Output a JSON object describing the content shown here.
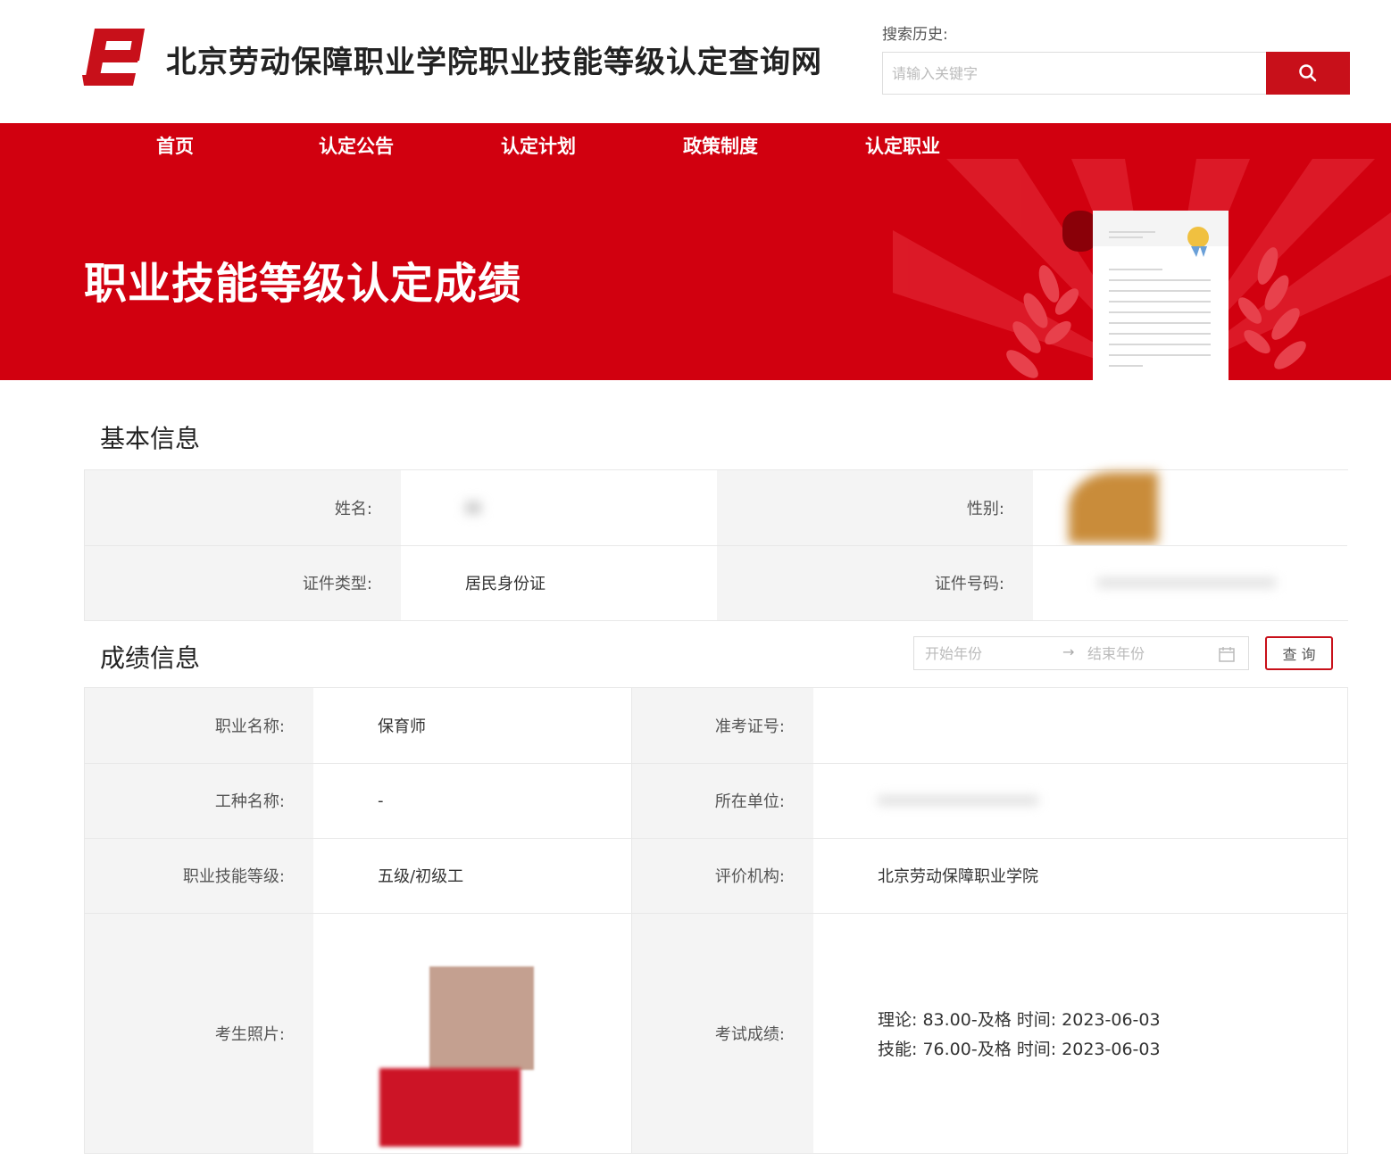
{
  "header": {
    "site_title": "北京劳动保障职业学院职业技能等级认定查询网",
    "search_history_label": "搜索历史:",
    "search_placeholder": "请输入关键字",
    "brand_color": "#c8101a"
  },
  "nav": {
    "items": [
      {
        "label": "首页"
      },
      {
        "label": "认定公告"
      },
      {
        "label": "认定计划"
      },
      {
        "label": "政策制度"
      },
      {
        "label": "认定职业"
      }
    ]
  },
  "banner": {
    "title": "职业技能等级认定成绩",
    "background_color": "#d1000f"
  },
  "basic_info": {
    "section_title": "基本信息",
    "name_label": "姓名:",
    "name_value": "",
    "gender_label": "性别:",
    "gender_value": "",
    "id_type_label": "证件类型:",
    "id_type_value": "居民身份证",
    "id_number_label": "证件号码:",
    "id_number_value": ""
  },
  "score_info": {
    "section_title": "成绩信息",
    "start_year_placeholder": "开始年份",
    "end_year_placeholder": "结束年份",
    "date_separator": "→",
    "query_button": "查 询",
    "occupation_label": "职业名称:",
    "occupation_value": "保育师",
    "ticket_label": "准考证号:",
    "ticket_value": "",
    "work_type_label": "工种名称:",
    "work_type_value": "-",
    "unit_label": "所在单位:",
    "unit_value": "",
    "level_label": "职业技能等级:",
    "level_value": "五级/初级工",
    "agency_label": "评价机构:",
    "agency_value": "北京劳动保障职业学院",
    "photo_label": "考生照片:",
    "exam_score_label": "考试成绩:",
    "exam_scores": [
      "理论: 83.00-及格 时间: 2023-06-03",
      "技能: 76.00-及格 时间: 2023-06-03"
    ]
  }
}
